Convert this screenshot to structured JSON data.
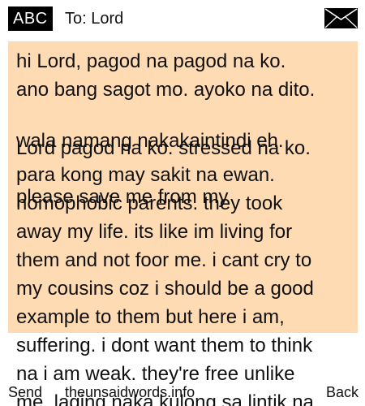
{
  "header": {
    "mode_badge": "ABC",
    "recipient": "To: Lord",
    "message_icon": "envelope-icon"
  },
  "message": {
    "line_1": "hi Lord, pagod na pagod na ko.",
    "line_2": "ano bang sagot mo. ayoko na dito.",
    "line_3": "wala namang nakakaintindi eh.",
    "line_4": "Lord pagod na ko. stressed na ko.",
    "line_5": "para kong may sakit na ewan.",
    "line_6": "please save me from my",
    "line_7": "homophobic parents. they took",
    "line_8": "away my life. its like im living for",
    "line_9": "them and not foor me. i cant cry to",
    "line_10": "my cousins coz i should be a good",
    "line_11": "example to them but here i am,",
    "line_12": "suffering. i dont want them to think",
    "line_13": "na i am weak. they're free unlike",
    "line_14": "me. laging naka kulong sa lintik na"
  },
  "softkeys": {
    "left": "Send",
    "center": "theunsaidwords.info",
    "right": "Back"
  },
  "colors": {
    "message_background": "#ffdbb4",
    "badge_background": "#000000",
    "badge_text": "#ffffff"
  }
}
